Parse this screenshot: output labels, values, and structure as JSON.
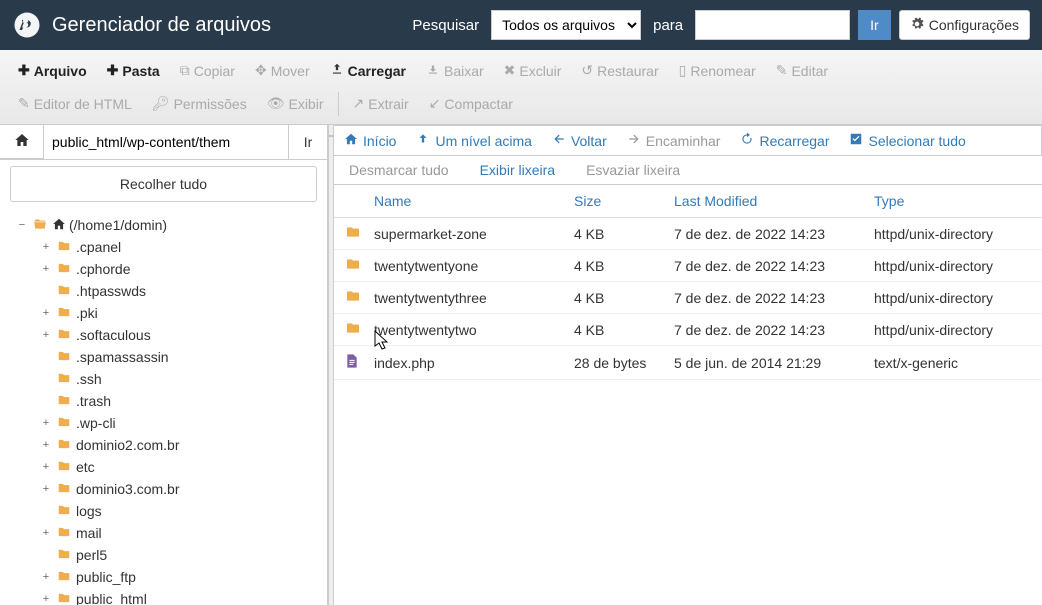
{
  "header": {
    "title": "Gerenciador de arquivos",
    "search_label": "Pesquisar",
    "search_scope": "Todos os arquivos",
    "for_label": "para",
    "go": "Ir",
    "settings": "Configurações"
  },
  "toolbar": {
    "file": "Arquivo",
    "folder": "Pasta",
    "copy": "Copiar",
    "move": "Mover",
    "upload": "Carregar",
    "download": "Baixar",
    "delete": "Excluir",
    "restore": "Restaurar",
    "rename": "Renomear",
    "edit": "Editar",
    "html_editor": "Editor de HTML",
    "permissions": "Permissões",
    "view": "Exibir",
    "extract": "Extrair",
    "compress": "Compactar"
  },
  "sidebar": {
    "path": "public_html/wp-content/them",
    "go": "Ir",
    "collapse_all": "Recolher tudo",
    "root_label": "(/home1/domin)",
    "tree": [
      {
        "label": ".cpanel",
        "depth": 1,
        "expandable": true
      },
      {
        "label": ".cphorde",
        "depth": 1,
        "expandable": true
      },
      {
        "label": ".htpasswds",
        "depth": 1,
        "expandable": false
      },
      {
        "label": ".pki",
        "depth": 1,
        "expandable": true
      },
      {
        "label": ".softaculous",
        "depth": 1,
        "expandable": true
      },
      {
        "label": ".spamassassin",
        "depth": 1,
        "expandable": false
      },
      {
        "label": ".ssh",
        "depth": 1,
        "expandable": false
      },
      {
        "label": ".trash",
        "depth": 1,
        "expandable": false
      },
      {
        "label": ".wp-cli",
        "depth": 1,
        "expandable": true
      },
      {
        "label": "dominio2.com.br",
        "depth": 1,
        "expandable": true
      },
      {
        "label": "etc",
        "depth": 1,
        "expandable": true
      },
      {
        "label": "dominio3.com.br",
        "depth": 1,
        "expandable": true
      },
      {
        "label": "logs",
        "depth": 1,
        "expandable": false
      },
      {
        "label": "mail",
        "depth": 1,
        "expandable": true
      },
      {
        "label": "perl5",
        "depth": 1,
        "expandable": false
      },
      {
        "label": "public_ftp",
        "depth": 1,
        "expandable": true
      },
      {
        "label": "public_html",
        "depth": 1,
        "expandable": true
      }
    ]
  },
  "nav": {
    "home": "Início",
    "up": "Um nível acima",
    "back": "Voltar",
    "forward": "Encaminhar",
    "reload": "Recarregar",
    "select_all": "Selecionar tudo",
    "deselect_all": "Desmarcar tudo",
    "show_trash": "Exibir lixeira",
    "empty_trash": "Esvaziar lixeira"
  },
  "table": {
    "headers": {
      "name": "Name",
      "size": "Size",
      "modified": "Last Modified",
      "type": "Type"
    },
    "rows": [
      {
        "icon": "folder",
        "name": "supermarket-zone",
        "size": "4 KB",
        "modified": "7 de dez. de 2022 14:23",
        "type": "httpd/unix-directory"
      },
      {
        "icon": "folder",
        "name": "twentytwentyone",
        "size": "4 KB",
        "modified": "7 de dez. de 2022 14:23",
        "type": "httpd/unix-directory"
      },
      {
        "icon": "folder",
        "name": "twentytwentythree",
        "size": "4 KB",
        "modified": "7 de dez. de 2022 14:23",
        "type": "httpd/unix-directory"
      },
      {
        "icon": "folder",
        "name": "twentytwentytwo",
        "size": "4 KB",
        "modified": "7 de dez. de 2022 14:23",
        "type": "httpd/unix-directory"
      },
      {
        "icon": "file",
        "name": "index.php",
        "size": "28 de bytes",
        "modified": "5 de jun. de 2014 21:29",
        "type": "text/x-generic"
      }
    ]
  }
}
